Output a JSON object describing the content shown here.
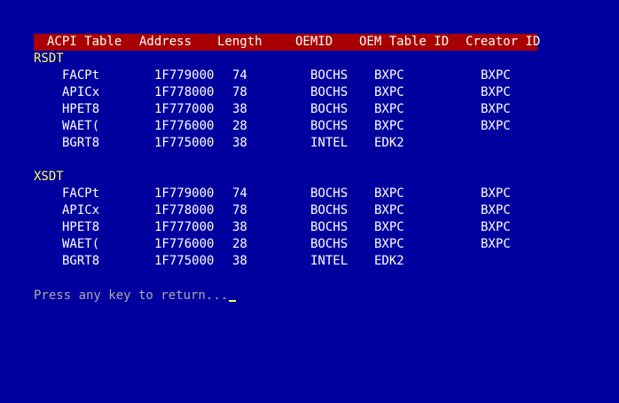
{
  "header": {
    "columns": [
      "ACPI Table",
      "Address",
      "Length",
      "OEMID",
      "OEM Table ID",
      "Creator ID"
    ]
  },
  "sections": [
    {
      "label": "RSDT",
      "rows": [
        [
          "FACPt",
          "1F779000",
          "74",
          "BOCHS",
          "BXPC",
          "BXPC"
        ],
        [
          "APICx",
          "1F778000",
          "78",
          "BOCHS",
          "BXPC",
          "BXPC"
        ],
        [
          "HPET8",
          "1F777000",
          "38",
          "BOCHS",
          "BXPC",
          "BXPC"
        ],
        [
          "WAET(",
          "1F776000",
          "28",
          "BOCHS",
          "BXPC",
          "BXPC"
        ],
        [
          "BGRT8",
          "1F775000",
          "38",
          "INTEL",
          "EDK2",
          ""
        ]
      ]
    },
    {
      "label": "XSDT",
      "rows": [
        [
          "FACPt",
          "1F779000",
          "74",
          "BOCHS",
          "BXPC",
          "BXPC"
        ],
        [
          "APICx",
          "1F778000",
          "78",
          "BOCHS",
          "BXPC",
          "BXPC"
        ],
        [
          "HPET8",
          "1F777000",
          "38",
          "BOCHS",
          "BXPC",
          "BXPC"
        ],
        [
          "WAET(",
          "1F776000",
          "28",
          "BOCHS",
          "BXPC",
          "BXPC"
        ],
        [
          "BGRT8",
          "1F775000",
          "38",
          "INTEL",
          "EDK2",
          ""
        ]
      ]
    }
  ],
  "prompt": "Press any key to return...",
  "colors": {
    "background": "#00009e",
    "header_bar": "#a80000",
    "section_label": "#ffff55",
    "prompt": "#aaaaaa",
    "text": "#ffffff"
  }
}
